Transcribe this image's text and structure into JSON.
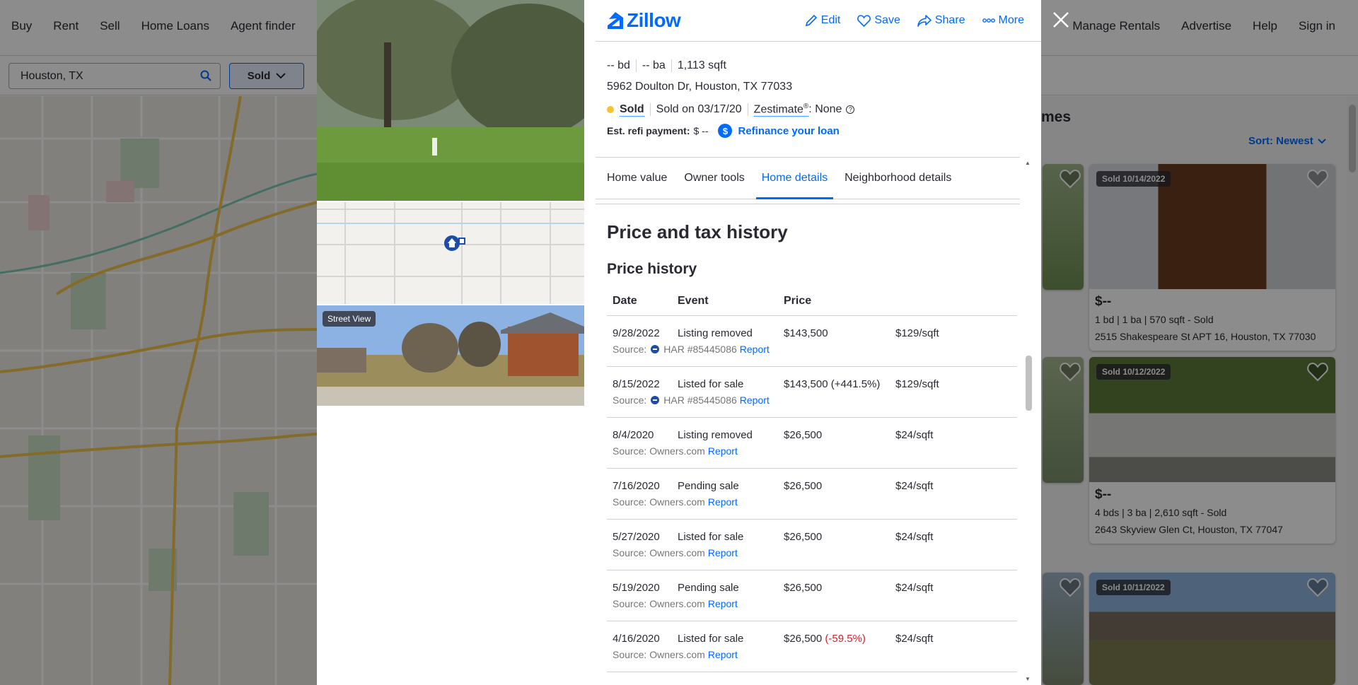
{
  "topnav": {
    "left": [
      "Buy",
      "Rent",
      "Sell",
      "Home Loans",
      "Agent finder"
    ],
    "right": [
      "Manage Rentals",
      "Advertise",
      "Help",
      "Sign in"
    ]
  },
  "search": {
    "value": "Houston, TX",
    "sold_label": "Sold"
  },
  "results": {
    "heading": "mes",
    "sort_label": "Sort: Newest",
    "cards": [
      {
        "badge": "Sold 10/14/2022",
        "price": "$--",
        "facts": "1 bd | 1 ba | 570 sqft - Sold",
        "address": "2515 Shakespeare St APT 16, Houston, TX 77030"
      },
      {
        "badge": "Sold 10/12/2022",
        "price": "$--",
        "facts": "4 bds | 3 ba | 2,610 sqft - Sold",
        "address": "2643 Skyview Glen Ct, Houston, TX 77047"
      },
      {
        "badge": "Sold 10/11/2022"
      }
    ]
  },
  "modal": {
    "logo": "Zillow",
    "actions": {
      "edit": "Edit",
      "save": "Save",
      "share": "Share",
      "more": "More"
    },
    "street_view": "Street View",
    "summary": {
      "beds": "-- bd",
      "baths": "-- ba",
      "sqft": "1,113 sqft",
      "address": "5962 Doulton Dr, Houston, TX 77033",
      "status": "Sold",
      "sold_on": "Sold on 03/17/20",
      "zestimate_label": "Zestimate",
      "zestimate_reg": "®",
      "zestimate_value": ": None",
      "refi_label": "Est. refi payment:",
      "refi_value": "$ --",
      "refi_link": "Refinance your loan"
    },
    "tabs": [
      "Home value",
      "Owner tools",
      "Home details",
      "Neighborhood details"
    ],
    "active_tab": "Home details",
    "section_title": "Price and tax history",
    "price_history": {
      "title": "Price history",
      "columns": [
        "Date",
        "Event",
        "Price"
      ],
      "rows": [
        {
          "date": "9/28/2022",
          "event": "Listing removed",
          "price": "$143,500",
          "change": "",
          "per_sqft": "$129/sqft",
          "source": "HAR #85445086",
          "har": true,
          "report": "Report"
        },
        {
          "date": "8/15/2022",
          "event": "Listed for sale",
          "price": "$143,500",
          "change": "(+441.5%)",
          "per_sqft": "$129/sqft",
          "source": "HAR #85445086",
          "har": true,
          "report": "Report"
        },
        {
          "date": "8/4/2020",
          "event": "Listing removed",
          "price": "$26,500",
          "change": "",
          "per_sqft": "$24/sqft",
          "source": "Owners.com",
          "har": false,
          "report": "Report"
        },
        {
          "date": "7/16/2020",
          "event": "Pending sale",
          "price": "$26,500",
          "change": "",
          "per_sqft": "$24/sqft",
          "source": "Owners.com",
          "har": false,
          "report": "Report"
        },
        {
          "date": "5/27/2020",
          "event": "Listed for sale",
          "price": "$26,500",
          "change": "",
          "per_sqft": "$24/sqft",
          "source": "Owners.com",
          "har": false,
          "report": "Report"
        },
        {
          "date": "5/19/2020",
          "event": "Pending sale",
          "price": "$26,500",
          "change": "",
          "per_sqft": "$24/sqft",
          "source": "Owners.com",
          "har": false,
          "report": "Report"
        },
        {
          "date": "4/16/2020",
          "event": "Listed for sale",
          "price": "$26,500",
          "change": "(-59.5%)",
          "per_sqft": "$24/sqft",
          "source": "Owners.com",
          "har": false,
          "report": "Report"
        }
      ]
    },
    "source_prefix": "Source:"
  },
  "colors": {
    "accent": "#006aff",
    "sold_dot": "#f4c430",
    "negative": "#d1232a",
    "text": "#2a2a33"
  }
}
